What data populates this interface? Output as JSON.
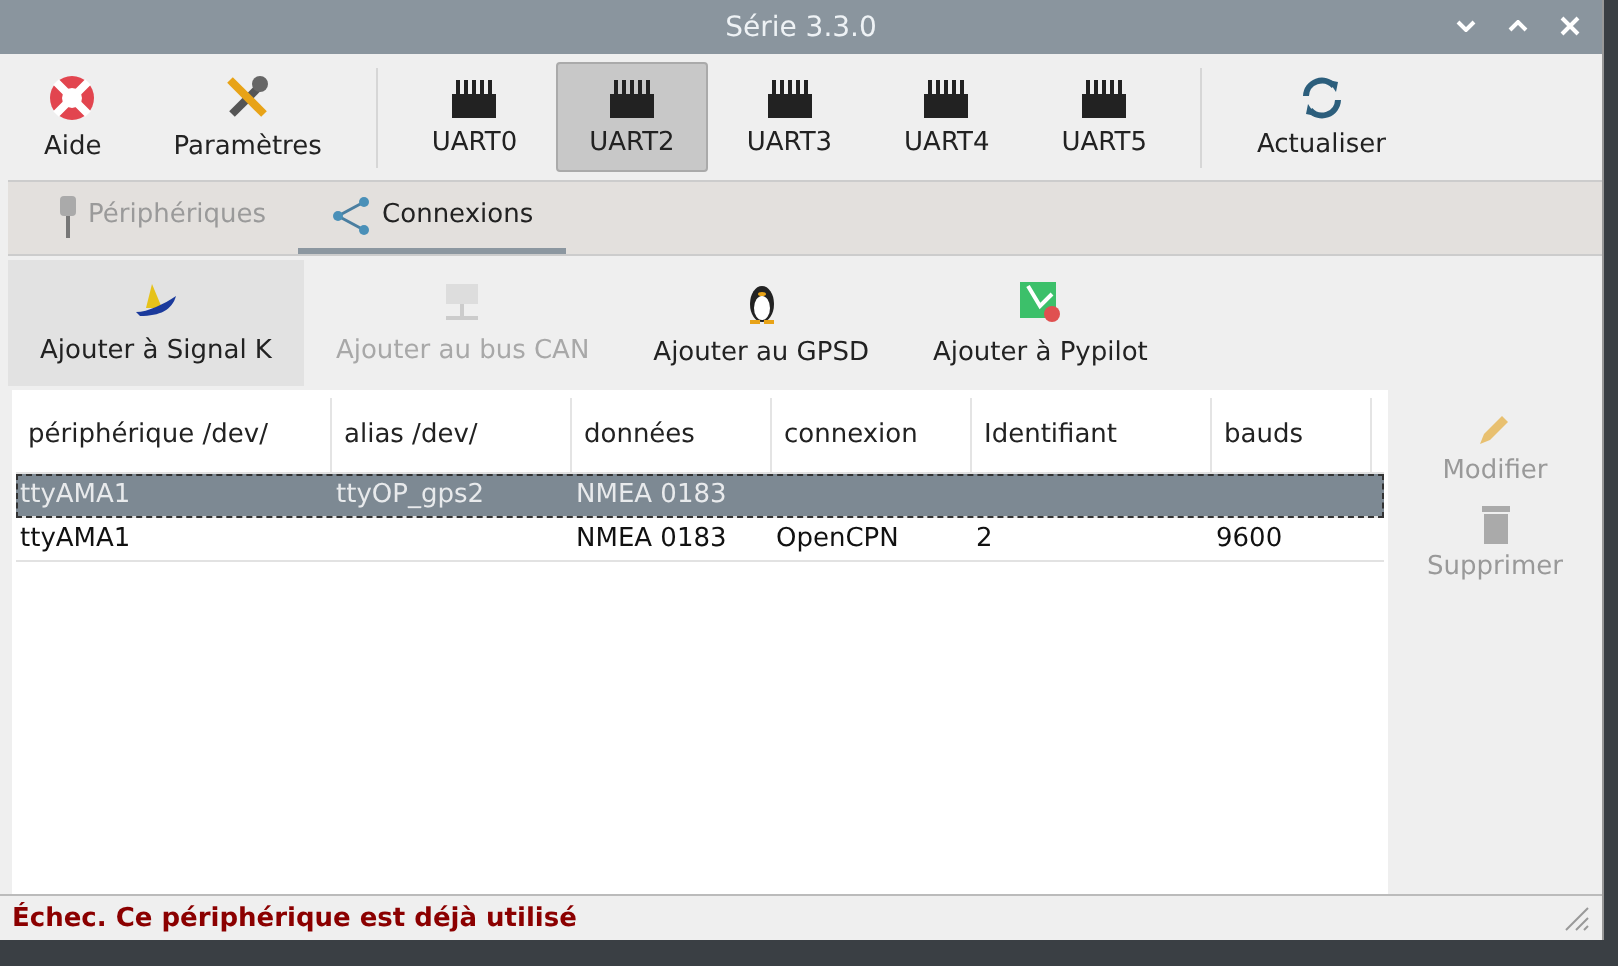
{
  "window": {
    "title": "Série 3.3.0"
  },
  "toolbar": [
    {
      "kind": "help",
      "label": "Aide",
      "selected": false
    },
    {
      "kind": "settings",
      "label": "Paramètres",
      "selected": false
    },
    {
      "kind": "separator"
    },
    {
      "kind": "port",
      "label": "UART0",
      "selected": false
    },
    {
      "kind": "port",
      "label": "UART2",
      "selected": true
    },
    {
      "kind": "port",
      "label": "UART3",
      "selected": false
    },
    {
      "kind": "port",
      "label": "UART4",
      "selected": false
    },
    {
      "kind": "port",
      "label": "UART5",
      "selected": false
    },
    {
      "kind": "separator"
    },
    {
      "kind": "refresh",
      "label": "Actualiser",
      "selected": false
    }
  ],
  "tabs": [
    {
      "kind": "plug",
      "label": "Périphériques",
      "selected": false,
      "disabled": true
    },
    {
      "kind": "share",
      "label": "Connexions",
      "selected": true,
      "disabled": false
    }
  ],
  "actions": [
    {
      "kind": "signalk",
      "label": "Ajouter à Signal K",
      "disabled": false,
      "selected": true
    },
    {
      "kind": "can",
      "label": "Ajouter au bus CAN",
      "disabled": true,
      "selected": false
    },
    {
      "kind": "gpsd",
      "label": "Ajouter au GPSD",
      "disabled": false,
      "selected": false
    },
    {
      "kind": "pypilot",
      "label": "Ajouter à Pypilot",
      "disabled": false,
      "selected": false
    }
  ],
  "table": {
    "columns": [
      "périphérique /dev/",
      "alias /dev/",
      "données",
      "connexion",
      "Identifiant",
      "bauds"
    ],
    "rows": [
      {
        "cells": [
          "ttyAMA1",
          "ttyOP_gps2",
          "NMEA 0183",
          "",
          "",
          ""
        ],
        "selected": true
      },
      {
        "cells": [
          "ttyAMA1",
          "",
          "NMEA 0183",
          "OpenCPN",
          "2",
          "9600"
        ],
        "selected": false
      }
    ]
  },
  "side_buttons": [
    {
      "kind": "edit",
      "label": "Modifier",
      "disabled": true
    },
    {
      "kind": "delete",
      "label": "Supprimer",
      "disabled": true
    }
  ],
  "status_bar": {
    "message": "Échec. Ce périphérique est déjà utilisé"
  }
}
